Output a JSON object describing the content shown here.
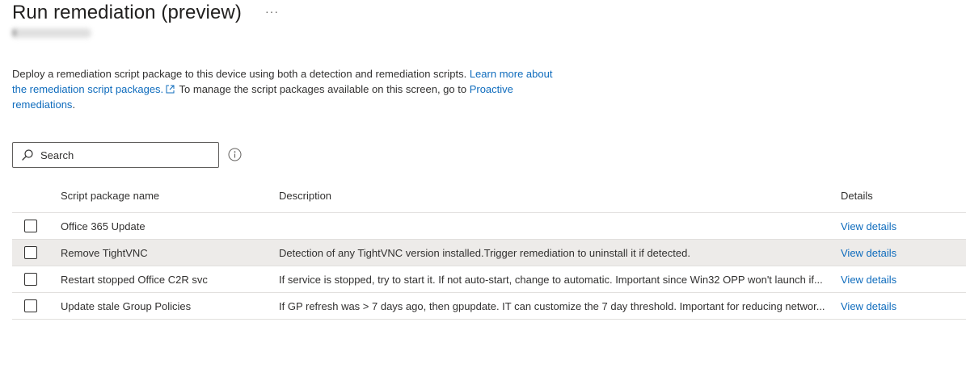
{
  "page": {
    "title": "Run remediation (preview)",
    "more_label": "···"
  },
  "intro": {
    "part1": "Deploy a remediation script package to this device using both a detection and remediation scripts. ",
    "link1": "Learn more about the remediation script packages.",
    "part2": " To manage the script packages available on this screen, go to ",
    "link2": "Proactive remediations",
    "part3": "."
  },
  "search": {
    "placeholder": "Search"
  },
  "table": {
    "columns": {
      "name": "Script package name",
      "description": "Description",
      "details": "Details"
    },
    "rows": [
      {
        "name": "Office 365 Update",
        "description": "",
        "details": "View details",
        "selected": false
      },
      {
        "name": "Remove TightVNC",
        "description": "Detection of any TightVNC version installed.Trigger remediation to uninstall it if detected.",
        "details": "View details",
        "selected": false
      },
      {
        "name": "Restart stopped Office C2R svc",
        "description": "If service is stopped, try to start it. If not auto-start, change to automatic. Important since Win32 OPP won't launch if...",
        "details": "View details",
        "selected": false
      },
      {
        "name": "Update stale Group Policies",
        "description": "If GP refresh was > 7 days ago, then gpupdate. IT can customize the 7 day threshold. Important for reducing networ...",
        "details": "View details",
        "selected": false
      }
    ]
  },
  "colors": {
    "accent": "#0f6cbd",
    "hover_row": "#edebe9",
    "border": "#e1dfdd"
  }
}
